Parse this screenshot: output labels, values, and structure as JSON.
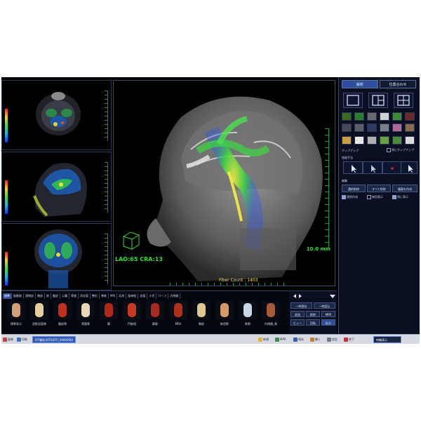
{
  "panel": {
    "tabs": [
      "解析",
      "位置合わせ"
    ],
    "popup_label": "ポップアップ",
    "popup_checkbox": "常にポップアップ",
    "select_section": "描画手法",
    "edit_section": "編集",
    "buttons": [
      "選択削除",
      "すべて削除",
      "複製を作成"
    ],
    "checkboxes": [
      {
        "label": "連続作成",
        "checked": true
      },
      {
        "label": "毎回表示",
        "checked": false
      },
      {
        "label": "常に表示",
        "checked": true
      }
    ]
  },
  "viewer": {
    "view_angle": "LAO:65 CRA:13",
    "scale": "10.0 mm",
    "fiber_count": "Fiber Count : 1403"
  },
  "strip": {
    "tabs": [
      "標準",
      "脳動脈",
      "頭頸部",
      "胸部",
      "肺",
      "腹部",
      "心臓",
      "骨盤",
      "消化管",
      "整形",
      "脊椎",
      "MRI",
      "乳房",
      "脳神経",
      "血管",
      "小児",
      "パーツ",
      "内視鏡"
    ],
    "organs": [
      {
        "label": "標準表示",
        "color": "#d4a07a"
      },
      {
        "label": "造影血管像",
        "color": "#e8cfa0"
      },
      {
        "label": "腹部骨",
        "color": "#c0301e"
      },
      {
        "label": "骨盤骨",
        "color": "#e8d8b8"
      },
      {
        "label": "脚",
        "color": "#b02818"
      },
      {
        "label": "門脈相",
        "color": "#c83a20"
      },
      {
        "label": "静脈",
        "color": "#a82a20"
      },
      {
        "label": "MRA",
        "color": "#b0301c"
      },
      {
        "label": "胸部",
        "color": "#e0c890"
      },
      {
        "label": "肺造影",
        "color": "#d89a6a"
      },
      {
        "label": "肺野",
        "color": "#c8d8e8"
      },
      {
        "label": "内視鏡_胃",
        "color": "#a85a38"
      }
    ]
  },
  "strip_right": {
    "buttons": [
      "一時保存",
      "一時読込",
      "追加",
      "削除",
      "MPR",
      "ビュー",
      "回転",
      "拡大"
    ]
  },
  "taskbar": {
    "items": [
      "画像",
      "切取",
      "新規",
      "MPR",
      "保存",
      "開く",
      "設定",
      "終了"
    ],
    "active_window": "DTI解析(DTI)(DTI_0000000)",
    "status": "待機表示"
  }
}
